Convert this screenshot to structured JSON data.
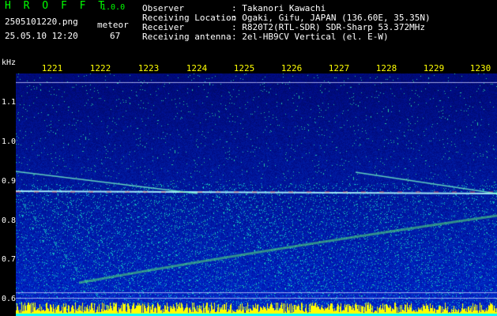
{
  "app": {
    "logo": "H R O F F T",
    "version": "1.0.0",
    "filename": "2505101220.png",
    "datetime": "25.05.10 12:20",
    "count_label": "meteor",
    "count_value": "67"
  },
  "info": {
    "rows": [
      {
        "label": "Observer",
        "value": ": Takanori Kawachi"
      },
      {
        "label": "Receiving Location",
        "value": ": Ogaki, Gifu, JAPAN (136.60E, 35.35N)"
      },
      {
        "label": "Receiver",
        "value": ": R820T2(RTL-SDR) SDR-Sharp 53.372MHz"
      },
      {
        "label": "Receiving antenna",
        "value": ": 2el-HB9CV Vertical (el. E-W)"
      }
    ]
  },
  "axis": {
    "unit": "kHz",
    "time_ticks": [
      "1221",
      "1222",
      "1223",
      "1224",
      "1225",
      "1226",
      "1227",
      "1228",
      "1229",
      "1230"
    ],
    "freq_ticks": [
      "1.1",
      "1.0",
      "0.9",
      "0.8",
      "0.7",
      "0.6"
    ]
  },
  "colors": {
    "background": "#000000",
    "label": "#ffffff",
    "tick": "#ffff00",
    "logo": "#00ff00",
    "spectro_base": "#0a1a8c",
    "signal": "#ff4040",
    "level_bar": "#ffff00",
    "level_base": "#00ffff"
  }
}
